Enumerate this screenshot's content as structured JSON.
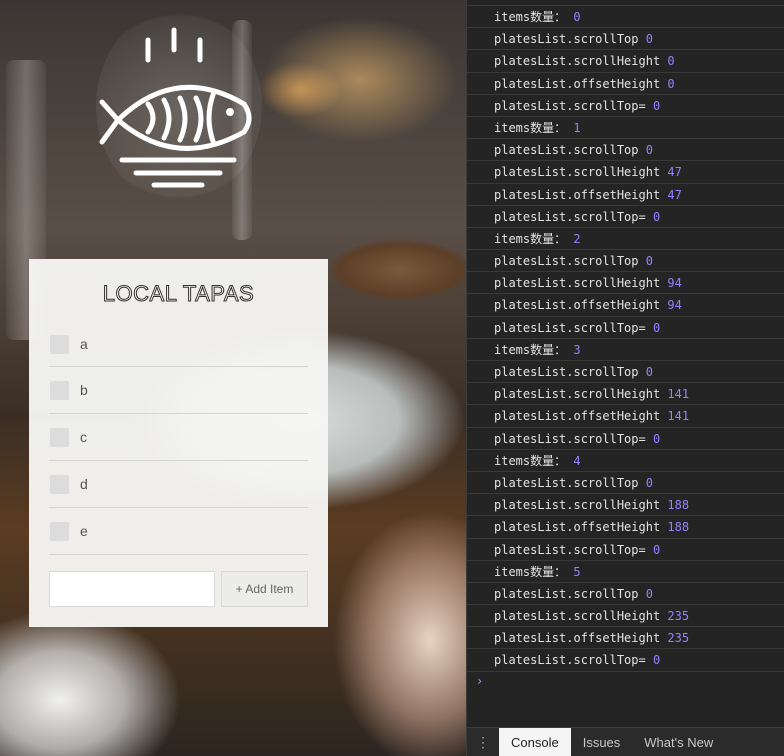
{
  "app": {
    "title": "LOCAL TAPAS",
    "plates": [
      {
        "label": "a",
        "done": false
      },
      {
        "label": "b",
        "done": false
      },
      {
        "label": "c",
        "done": false
      },
      {
        "label": "d",
        "done": false
      },
      {
        "label": "e",
        "done": false
      }
    ],
    "add_input_value": "",
    "add_button_label": "+ Add Item"
  },
  "console": {
    "lines": [
      {
        "key": "items数量：",
        "value": "0"
      },
      {
        "key": "platesList.scrollTop",
        "value": "0"
      },
      {
        "key": "platesList.scrollHeight",
        "value": "0"
      },
      {
        "key": "platesList.offsetHeight",
        "value": "0"
      },
      {
        "key": "platesList.scrollTop=",
        "value": "0"
      },
      {
        "key": "items数量：",
        "value": "1"
      },
      {
        "key": "platesList.scrollTop",
        "value": "0"
      },
      {
        "key": "platesList.scrollHeight",
        "value": "47"
      },
      {
        "key": "platesList.offsetHeight",
        "value": "47"
      },
      {
        "key": "platesList.scrollTop=",
        "value": "0"
      },
      {
        "key": "items数量：",
        "value": "2"
      },
      {
        "key": "platesList.scrollTop",
        "value": "0"
      },
      {
        "key": "platesList.scrollHeight",
        "value": "94"
      },
      {
        "key": "platesList.offsetHeight",
        "value": "94"
      },
      {
        "key": "platesList.scrollTop=",
        "value": "0"
      },
      {
        "key": "items数量：",
        "value": "3"
      },
      {
        "key": "platesList.scrollTop",
        "value": "0"
      },
      {
        "key": "platesList.scrollHeight",
        "value": "141"
      },
      {
        "key": "platesList.offsetHeight",
        "value": "141"
      },
      {
        "key": "platesList.scrollTop=",
        "value": "0"
      },
      {
        "key": "items数量：",
        "value": "4"
      },
      {
        "key": "platesList.scrollTop",
        "value": "0"
      },
      {
        "key": "platesList.scrollHeight",
        "value": "188"
      },
      {
        "key": "platesList.offsetHeight",
        "value": "188"
      },
      {
        "key": "platesList.scrollTop=",
        "value": "0"
      },
      {
        "key": "items数量：",
        "value": "5"
      },
      {
        "key": "platesList.scrollTop",
        "value": "0"
      },
      {
        "key": "platesList.scrollHeight",
        "value": "235"
      },
      {
        "key": "platesList.offsetHeight",
        "value": "235"
      },
      {
        "key": "platesList.scrollTop=",
        "value": "0"
      }
    ],
    "prompt_symbol": "›"
  },
  "drawer": {
    "menu_icon": "more-vertical-icon",
    "tabs": [
      {
        "label": "Console",
        "active": true
      },
      {
        "label": "Issues",
        "active": false
      },
      {
        "label": "What's New",
        "active": false
      }
    ]
  },
  "colors": {
    "console_value": "#9980ff",
    "devtools_bg": "#242424"
  }
}
